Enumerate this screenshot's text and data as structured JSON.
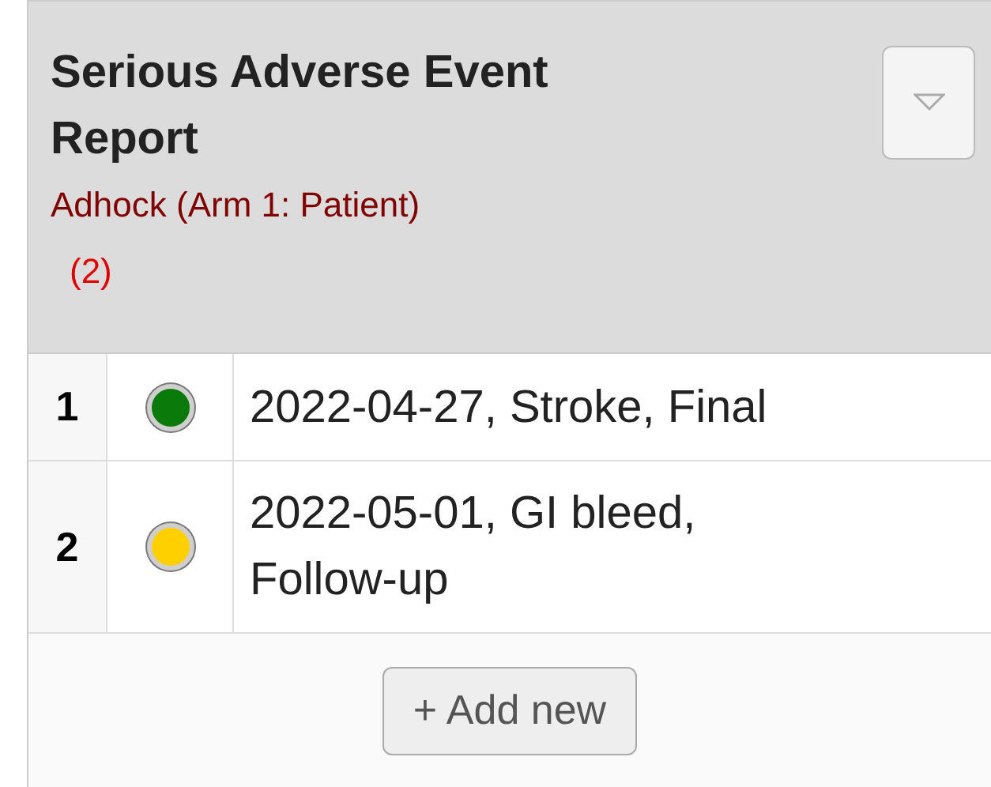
{
  "header": {
    "title": "Serious Adverse Event Report",
    "subtitle": "Adhock (Arm 1: Patient)",
    "count": "(2)"
  },
  "rows": [
    {
      "number": "1",
      "color": "#0a7a0a",
      "text": "2022-04-27, Stroke, Final"
    },
    {
      "number": "2",
      "color": "#ffd000",
      "text": "2022-05-01, GI bleed, Follow-up"
    }
  ],
  "add_button": "+ Add new"
}
